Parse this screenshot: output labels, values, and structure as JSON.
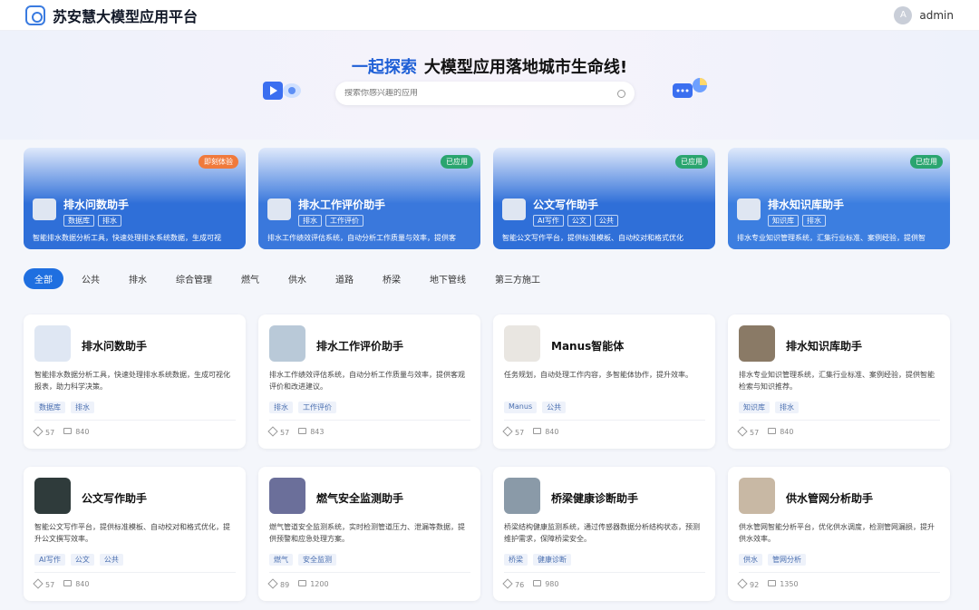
{
  "header": {
    "brand": "苏安慧大模型应用平台",
    "user": "admin",
    "avatar_letter": "A"
  },
  "hero": {
    "highlight": "一起探索",
    "title": "大模型应用落地城市生命线!",
    "search_placeholder": "搜索你感兴趣的应用"
  },
  "featured": [
    {
      "tag": "即刻体验",
      "tag_color": "#f07a3c",
      "title": "排水问数助手",
      "tags": [
        "数据库",
        "排水"
      ],
      "desc": "智能排水数据分析工具，快速处理排水系统数据，生成可视",
      "bg": "#2f6fd8"
    },
    {
      "tag": "已应用",
      "tag_color": "#2aa56f",
      "title": "排水工作评价助手",
      "tags": [
        "排水",
        "工作评价"
      ],
      "desc": "排水工作绩效评估系统，自动分析工作质量与效率，提供客",
      "bg": "#3a78dc"
    },
    {
      "tag": "已应用",
      "tag_color": "#2aa56f",
      "title": "公文写作助手",
      "tags": [
        "AI写作",
        "公文",
        "公共"
      ],
      "desc": "智能公文写作平台，提供标准模板、自动校对和格式优化",
      "bg": "#2f6fd8"
    },
    {
      "tag": "已应用",
      "tag_color": "#2aa56f",
      "title": "排水知识库助手",
      "tags": [
        "知识库",
        "排水"
      ],
      "desc": "排水专业知识管理系统，汇集行业标准、案例经验，提供智",
      "bg": "#3c7ee0"
    }
  ],
  "filters": [
    "全部",
    "公共",
    "排水",
    "综合管理",
    "燃气",
    "供水",
    "道路",
    "桥梁",
    "地下管线",
    "第三方施工"
  ],
  "cards": [
    {
      "title": "排水问数助手",
      "desc": "智能排水数据分析工具，快速处理排水系统数据，生成可视化报表，助力科学决策。",
      "tags": [
        "数据库",
        "排水"
      ],
      "stars": "57",
      "views": "840",
      "thumb": "#dfe7f3"
    },
    {
      "title": "排水工作评价助手",
      "desc": "排水工作绩效评估系统，自动分析工作质量与效率，提供客观评价和改进建议。",
      "tags": [
        "排水",
        "工作评价"
      ],
      "stars": "57",
      "views": "843",
      "thumb": "#b9c9d8"
    },
    {
      "title": "Manus智能体",
      "desc": "任务规划，自动处理工作内容，多智能体协作，提升效率。",
      "tags": [
        "Manus",
        "公共"
      ],
      "stars": "57",
      "views": "840",
      "thumb": "#e9e6e1"
    },
    {
      "title": "排水知识库助手",
      "desc": "排水专业知识管理系统，汇集行业标准、案例经验，提供智能检索与知识推荐。",
      "tags": [
        "知识库",
        "排水"
      ],
      "stars": "57",
      "views": "840",
      "thumb": "#8a7a66"
    },
    {
      "title": "公文写作助手",
      "desc": "智能公文写作平台，提供标准模板、自动校对和格式优化，提升公文撰写效率。",
      "tags": [
        "AI写作",
        "公文",
        "公共"
      ],
      "stars": "57",
      "views": "840",
      "thumb": "#2f3b3b"
    },
    {
      "title": "燃气安全监测助手",
      "desc": "燃气管道安全监测系统，实时检测管道压力、泄漏等数据，提供预警和应急处理方案。",
      "tags": [
        "燃气",
        "安全监测"
      ],
      "stars": "89",
      "views": "1200",
      "thumb": "#6b6f9a"
    },
    {
      "title": "桥梁健康诊断助手",
      "desc": "桥梁结构健康监测系统，通过传感器数据分析结构状态，预测维护需求，保障桥梁安全。",
      "tags": [
        "桥梁",
        "健康诊断"
      ],
      "stars": "76",
      "views": "980",
      "thumb": "#8a9aa8"
    },
    {
      "title": "供水管网分析助手",
      "desc": "供水管网智能分析平台，优化供水调度，检测管网漏损，提升供水效率。",
      "tags": [
        "供水",
        "管网分析"
      ],
      "stars": "92",
      "views": "1350",
      "thumb": "#c8b8a4"
    }
  ]
}
